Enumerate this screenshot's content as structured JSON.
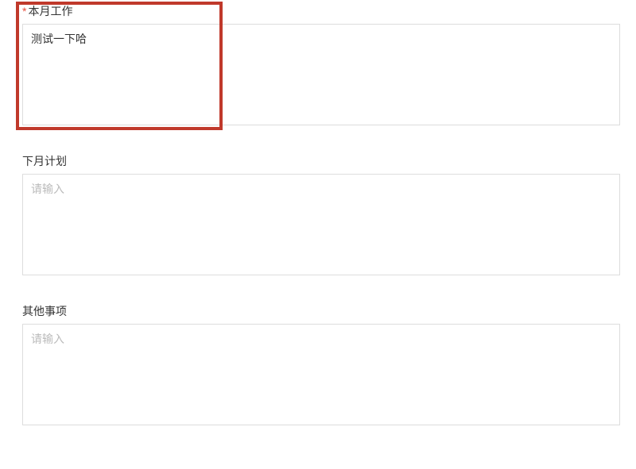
{
  "form": {
    "fields": [
      {
        "label": "本月工作",
        "required": true,
        "value": "测试一下哈",
        "placeholder": "请输入",
        "highlighted": true
      },
      {
        "label": "下月计划",
        "required": false,
        "value": "",
        "placeholder": "请输入",
        "highlighted": false
      },
      {
        "label": "其他事项",
        "required": false,
        "value": "",
        "placeholder": "请输入",
        "highlighted": false
      }
    ],
    "required_mark": "*"
  }
}
